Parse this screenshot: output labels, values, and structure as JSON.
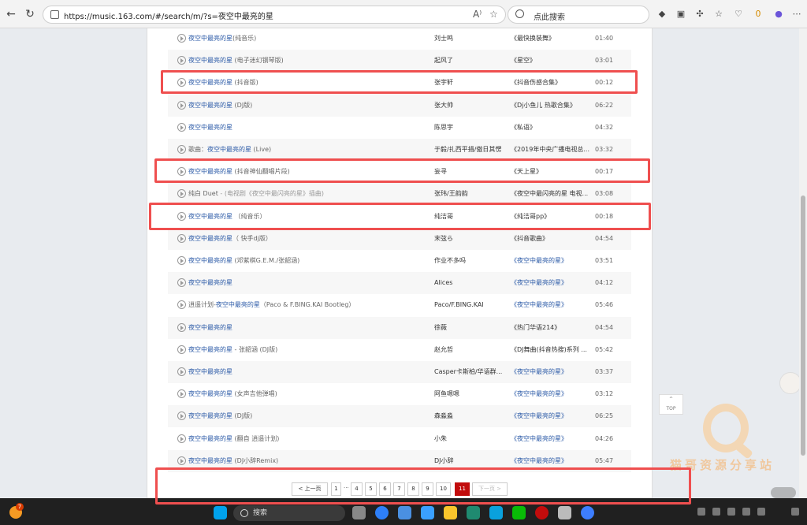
{
  "browser": {
    "url": "https://music.163.com/#/search/m/?s=夜空中最亮的星",
    "search_placeholder": "点此搜索",
    "read_aloud": "A⁾",
    "profile_badge": "0"
  },
  "results": [
    {
      "title_parts": [
        {
          "text": "夜空中最亮的星",
          "style": "blue"
        },
        {
          "text": "(纯音乐)",
          "style": "grey"
        }
      ],
      "artist": "刘士鸣",
      "album": "《最快换装舞》",
      "album_blue": false,
      "duration": "01:40"
    },
    {
      "title_parts": [
        {
          "text": "夜空中最亮的星",
          "style": "blue"
        },
        {
          "text": " (电子迷幻钢琴版)",
          "style": "grey"
        }
      ],
      "artist": "起风了",
      "album": "《星空》",
      "album_blue": false,
      "duration": "03:01"
    },
    {
      "title_parts": [
        {
          "text": "夜空中最亮的星",
          "style": "blue"
        },
        {
          "text": " (抖音版)",
          "style": "grey"
        }
      ],
      "artist": "张宇轩",
      "album": "《抖音伤感合集》",
      "album_blue": false,
      "duration": "00:12"
    },
    {
      "title_parts": [
        {
          "text": "夜空中最亮的星",
          "style": "blue"
        },
        {
          "text": " (DJ版)",
          "style": "grey"
        }
      ],
      "artist": "张大帅",
      "album": "《Dj小鱼儿 热歌合集》",
      "album_blue": false,
      "duration": "06:22"
    },
    {
      "title_parts": [
        {
          "text": "夜空中最亮的星",
          "style": "blue"
        }
      ],
      "artist": "陈思宇",
      "album": "《私语》",
      "album_blue": false,
      "duration": "04:32"
    },
    {
      "title_parts": [
        {
          "text": "歌曲：",
          "style": "grey"
        },
        {
          "text": "夜空中最亮的星",
          "style": "blue"
        },
        {
          "text": " (Live)",
          "style": "grey"
        }
      ],
      "artist": "于毅/扎西平措/傲日其愣",
      "album": "《2019年中央广播电视总...",
      "album_blue": false,
      "duration": "03:32"
    },
    {
      "title_parts": [
        {
          "text": "夜空中最亮的星",
          "style": "blue"
        },
        {
          "text": " (抖音神仙翻唱片段)",
          "style": "grey"
        }
      ],
      "artist": "妄寻",
      "album": "《天上星》",
      "album_blue": false,
      "duration": "00:17"
    },
    {
      "title_parts": [
        {
          "text": "纯白 Duet",
          "style": "grey"
        },
        {
          "text": " - (电视剧《夜空中最闪亮的星》插曲)",
          "style": "light"
        }
      ],
      "artist": "张玮/王韵韵",
      "album": "《夜空中最闪亮的星 电视...",
      "album_blue": false,
      "duration": "03:08"
    },
    {
      "title_parts": [
        {
          "text": "夜空中最亮的星",
          "style": "blue"
        },
        {
          "text": " （纯音乐）",
          "style": "grey"
        }
      ],
      "artist": "纯洁哥",
      "album": "《纯洁哥pp》",
      "album_blue": false,
      "duration": "00:18"
    },
    {
      "title_parts": [
        {
          "text": "夜空中最亮的星",
          "style": "blue"
        },
        {
          "text": "（ 快手dj版）",
          "style": "grey"
        }
      ],
      "artist": "末弦ら",
      "album": "《抖音歌曲》",
      "album_blue": false,
      "duration": "04:54"
    },
    {
      "title_parts": [
        {
          "text": "夜空中最亮的星",
          "style": "blue"
        },
        {
          "text": " (邓紫棋G.E.M./张韶涵)",
          "style": "grey"
        }
      ],
      "artist": "作业不多吗",
      "album": "《夜空中最亮的星》",
      "album_blue": true,
      "duration": "03:51"
    },
    {
      "title_parts": [
        {
          "text": "夜空中最亮的星",
          "style": "blue"
        }
      ],
      "artist": "Alices",
      "album": "《夜空中最亮的星》",
      "album_blue": true,
      "duration": "04:12"
    },
    {
      "title_parts": [
        {
          "text": "逍遥计划-",
          "style": "grey"
        },
        {
          "text": "夜空中最亮的星",
          "style": "blue"
        },
        {
          "text": "（Paco & F.BING.KAI Bootleg）",
          "style": "grey"
        }
      ],
      "artist": "Paco/F.BING.KAI",
      "album": "《夜空中最亮的星》",
      "album_blue": true,
      "duration": "05:46"
    },
    {
      "title_parts": [
        {
          "text": "夜空中最亮的星",
          "style": "blue"
        }
      ],
      "artist": "徐薇",
      "album": "《热门华语214》",
      "album_blue": false,
      "duration": "04:54"
    },
    {
      "title_parts": [
        {
          "text": "夜空中最亮的星",
          "style": "blue"
        },
        {
          "text": " - 张韶涵 (DJ版)",
          "style": "grey"
        }
      ],
      "artist": "赵允哲",
      "album": "《DJ舞曲(抖音热搜)系列 ...",
      "album_blue": false,
      "duration": "05:42"
    },
    {
      "title_parts": [
        {
          "text": "夜空中最亮的星",
          "style": "blue"
        }
      ],
      "artist": "Casper卡斯柏/华语群...",
      "album": "《夜空中最亮的星》",
      "album_blue": true,
      "duration": "03:37"
    },
    {
      "title_parts": [
        {
          "text": "夜空中最亮的星",
          "style": "blue"
        },
        {
          "text": " (女声吉他弹唱)",
          "style": "grey"
        }
      ],
      "artist": "阿鱼嗯嗯",
      "album": "《夜空中最亮的星》",
      "album_blue": true,
      "duration": "03:12"
    },
    {
      "title_parts": [
        {
          "text": "夜空中最亮的星",
          "style": "blue"
        },
        {
          "text": " (DJ版)",
          "style": "grey"
        }
      ],
      "artist": "森淼淼",
      "album": "《夜空中最亮的星》",
      "album_blue": true,
      "duration": "06:25"
    },
    {
      "title_parts": [
        {
          "text": "夜空中最亮的星",
          "style": "blue"
        },
        {
          "text": " (翻自 逍遥计划)",
          "style": "grey"
        }
      ],
      "artist": "小朱",
      "album": "《夜空中最亮的星》",
      "album_blue": true,
      "duration": "04:26"
    },
    {
      "title_parts": [
        {
          "text": "夜空中最亮的星",
          "style": "blue"
        },
        {
          "text": " (DJ小辞Remix)",
          "style": "grey"
        }
      ],
      "artist": "DJ小辞",
      "album": "《夜空中最亮的星》",
      "album_blue": true,
      "duration": "05:47"
    }
  ],
  "pagination": {
    "prev": "< 上一页",
    "pages": [
      "1",
      "4",
      "5",
      "6",
      "7",
      "8",
      "9",
      "10",
      "11"
    ],
    "ellipsis": "...",
    "active": "11",
    "next": "下一页 >"
  },
  "top_button": {
    "arrow": "^",
    "label": "TOP"
  },
  "watermark": "猫哥资源分享站",
  "taskbar": {
    "search_label": "搜索",
    "notification_count": "7"
  },
  "colors": {
    "link_blue": "#2b5aa7",
    "highlight_red": "#ef4f4f",
    "active_page": "#c20c0c",
    "watermark": "#f2c08b"
  }
}
